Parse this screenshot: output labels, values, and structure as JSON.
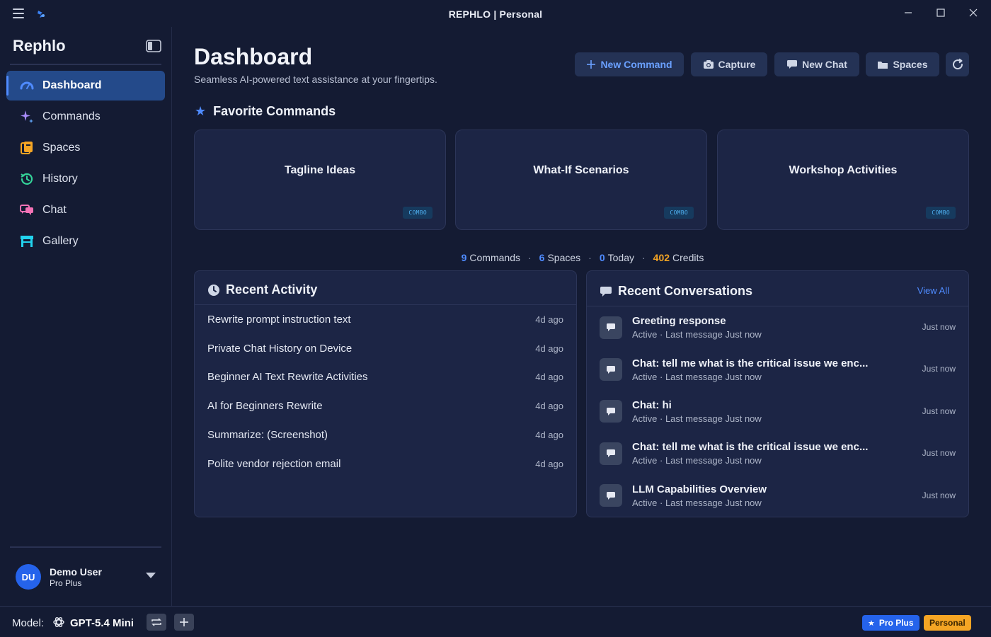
{
  "window": {
    "title": "REPHLO | Personal"
  },
  "sidebar": {
    "brand": "Rephlo",
    "items": [
      {
        "label": "Dashboard",
        "icon": "dashboard-gauge-icon",
        "active": true
      },
      {
        "label": "Commands",
        "icon": "sparkle-icon"
      },
      {
        "label": "Spaces",
        "icon": "spaces-folder-icon"
      },
      {
        "label": "History",
        "icon": "history-icon"
      },
      {
        "label": "Chat",
        "icon": "chat-bubbles-icon"
      },
      {
        "label": "Gallery",
        "icon": "storefront-icon"
      }
    ],
    "user": {
      "initials": "DU",
      "name": "Demo User",
      "plan": "Pro Plus"
    }
  },
  "header": {
    "title": "Dashboard",
    "subtitle": "Seamless AI-powered text assistance at your fingertips."
  },
  "toolbar": {
    "new_command": "New Command",
    "capture": "Capture",
    "new_chat": "New Chat",
    "spaces": "Spaces"
  },
  "favorites": {
    "heading": "Favorite Commands",
    "cards": [
      {
        "title": "Tagline Ideas",
        "badge": "COMBO"
      },
      {
        "title": "What-If Scenarios",
        "badge": "COMBO"
      },
      {
        "title": "Workshop Activities",
        "badge": "COMBO"
      }
    ]
  },
  "stats": {
    "commands_count": "9",
    "commands_label": "Commands",
    "spaces_count": "6",
    "spaces_label": "Spaces",
    "today_count": "0",
    "today_label": "Today",
    "credits_count": "402",
    "credits_label": "Credits",
    "separator": "·"
  },
  "recent_activity": {
    "title": "Recent Activity",
    "items": [
      {
        "title": "Rewrite prompt instruction text",
        "time": "4d ago"
      },
      {
        "title": "Private Chat History on Device",
        "time": "4d ago"
      },
      {
        "title": "Beginner AI Text Rewrite Activities",
        "time": "4d ago"
      },
      {
        "title": "AI for Beginners Rewrite",
        "time": "4d ago"
      },
      {
        "title": "Summarize: (Screenshot)",
        "time": "4d ago"
      },
      {
        "title": "Polite vendor rejection email",
        "time": "4d ago"
      }
    ]
  },
  "recent_conversations": {
    "title": "Recent Conversations",
    "view_all": "View All",
    "items": [
      {
        "title": "Greeting response",
        "status": "Active · Last message Just now",
        "time": "Just now"
      },
      {
        "title": "Chat: tell me what is the critical issue we enc...",
        "status": "Active · Last message Just now",
        "time": "Just now"
      },
      {
        "title": "Chat: hi",
        "status": "Active · Last message Just now",
        "time": "Just now"
      },
      {
        "title": "Chat: tell me what is the critical issue we enc...",
        "status": "Active · Last message Just now",
        "time": "Just now"
      },
      {
        "title": "LLM Capabilities Overview",
        "status": "Active · Last message Just now",
        "time": "Just now"
      }
    ]
  },
  "statusbar": {
    "model_label": "Model:",
    "model_name": "GPT-5.4 Mini",
    "plan_badge": "Pro Plus",
    "workspace_badge": "Personal"
  },
  "colors": {
    "accent": "#4f8bff",
    "active_nav": "#244a8a",
    "credits": "#f5a524",
    "background": "#141b33",
    "card": "#1c2545"
  }
}
